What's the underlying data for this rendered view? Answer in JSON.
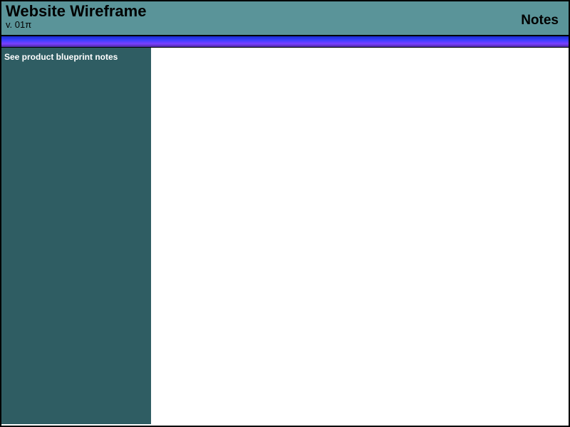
{
  "header": {
    "title": "Website Wireframe",
    "version": "v. 01π",
    "right_label": "Notes"
  },
  "sidebar": {
    "note": "See product blueprint notes"
  },
  "colors": {
    "header_bg": "#5a9499",
    "sidebar_bg": "#2f5d63",
    "topbar_gradient_start": "#1a2fcf",
    "topbar_gradient_end": "#4a2a9f"
  }
}
